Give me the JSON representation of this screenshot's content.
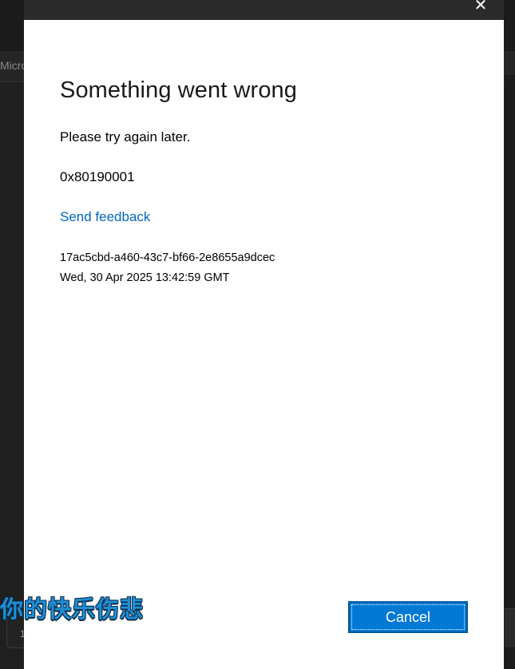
{
  "background": {
    "tab_text": "Micro",
    "bottom_left_text": "1"
  },
  "dialog": {
    "close_glyph": "✕",
    "title": "Something went wrong",
    "message": "Please try again later.",
    "error_code": "0x80190001",
    "feedback_link": "Send feedback",
    "correlation_id": "17ac5cbd-a460-43c7-bf66-2e8655a9dcec",
    "timestamp": "Wed, 30 Apr 2025 13:42:59 GMT",
    "cancel_label": "Cancel"
  },
  "overlay": {
    "caption": "你的快乐伤悲"
  },
  "colors": {
    "link": "#0067c0",
    "primary_button": "#0078d4",
    "dark_background": "#202020",
    "caption_text": "#1e8fd6"
  },
  "icons": {
    "close": "close-icon"
  }
}
